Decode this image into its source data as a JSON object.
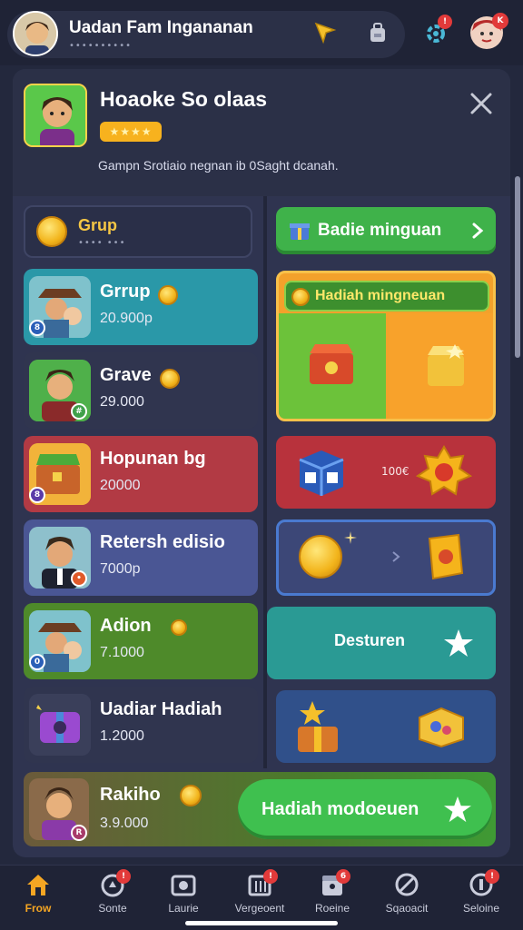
{
  "topbar": {
    "title": "Uadan Fam Ingananan",
    "subtitle": "••••••••••",
    "badge_notifications": "!",
    "badge_profile": "K"
  },
  "header": {
    "title": "Hoaoke So olaas",
    "stars": "★★★★",
    "description": "Gampn Srotiaio negnan ib 0Saght dcanah."
  },
  "group_header": {
    "label": "Grup",
    "sub": "•••• •••"
  },
  "left_rows": [
    {
      "name": "Grrup",
      "value": "20.900p"
    },
    {
      "name": "Grave",
      "value": "29.000"
    },
    {
      "name": "Hopunan bg",
      "value": "20000"
    },
    {
      "name": "Retersh edisio",
      "value": "7000p"
    },
    {
      "name": "Adion",
      "value": "7.1000"
    },
    {
      "name": "Uadiar Hadiah",
      "value": "1.2000"
    }
  ],
  "right": {
    "top_button": "Badie minguan",
    "box_banner": "Hadiah mingneuan",
    "red_card_text": "100€",
    "desturen_label": "Desturen"
  },
  "bottom_row": {
    "name": "Rakiho",
    "value": "3.9.000",
    "cta_label": "Hadiah modoeuen"
  },
  "nav": [
    {
      "label": "Frow"
    },
    {
      "label": "Sonte"
    },
    {
      "label": "Laurie"
    },
    {
      "label": "Vergeoent"
    },
    {
      "label": "Roeine"
    },
    {
      "label": "Sqaoacit"
    },
    {
      "label": "Seloine"
    }
  ],
  "colors": {
    "accent": "#f5a623",
    "green": "#3fb24a",
    "panel": "#2f3450"
  }
}
